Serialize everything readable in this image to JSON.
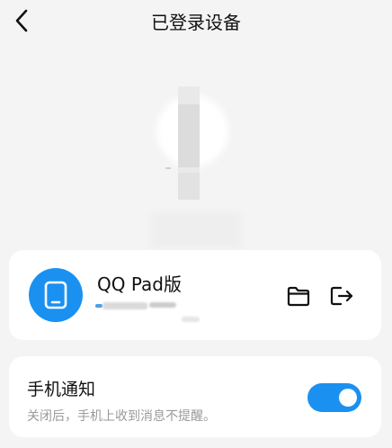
{
  "header": {
    "title": "已登录设备",
    "back_icon": "chevron-left-icon"
  },
  "device": {
    "name": "QQ Pad版",
    "avatar_icon": "tablet-icon",
    "accent_color": "#1a91f0",
    "actions": [
      {
        "icon": "folder-icon"
      },
      {
        "icon": "logout-icon"
      }
    ]
  },
  "notification": {
    "title": "手机通知",
    "description": "关闭后，手机上收到消息不提醒。",
    "toggle_on": true
  }
}
